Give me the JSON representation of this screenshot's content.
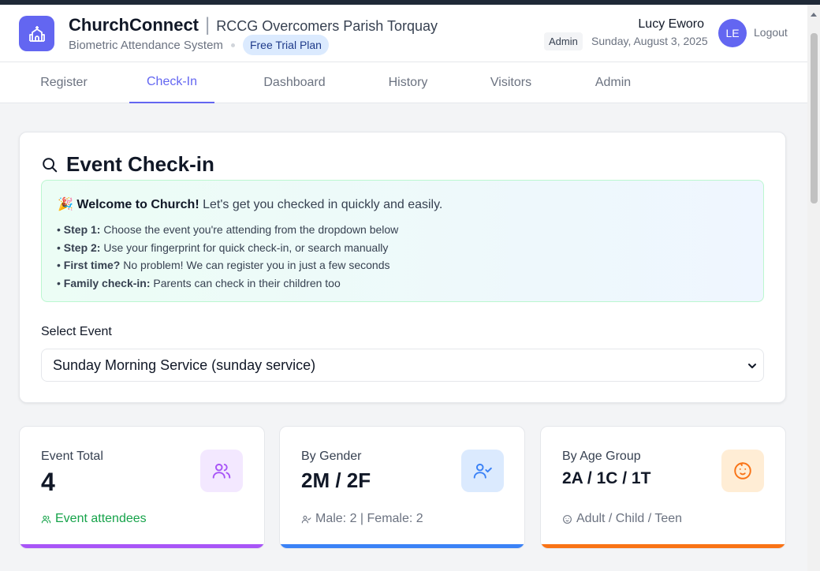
{
  "header": {
    "app_name": "ChurchConnect",
    "separator": "|",
    "parish": "RCCG Overcomers Parish Torquay",
    "system": "Biometric Attendance System",
    "plan_badge": "Free Trial Plan",
    "user_name": "Lucy Eworo",
    "role": "Admin",
    "date": "Sunday, August 3, 2025",
    "avatar_initials": "LE",
    "logout_label": "Logout"
  },
  "nav": {
    "tabs": [
      {
        "label": "Register"
      },
      {
        "label": "Check-In",
        "active": true
      },
      {
        "label": "Dashboard"
      },
      {
        "label": "History"
      },
      {
        "label": "Visitors"
      },
      {
        "label": "Admin"
      }
    ]
  },
  "checkin": {
    "title": "Event Check-in",
    "welcome_emoji": "🎉",
    "welcome_bold": "Welcome to Church!",
    "welcome_text": " Let's get you checked in quickly and easily.",
    "steps": [
      {
        "bold": "Step 1:",
        "text": " Choose the event you're attending from the dropdown below"
      },
      {
        "bold": "Step 2:",
        "text": " Use your fingerprint for quick check-in, or search manually"
      },
      {
        "bold": "First time?",
        "text": " No problem! We can register you in just a few seconds"
      },
      {
        "bold": "Family check-in:",
        "text": " Parents can check in their children too"
      }
    ],
    "select_label": "Select Event",
    "selected_event": "Sunday Morning Service (sunday service)"
  },
  "stats": [
    {
      "label": "Event Total",
      "value": "4",
      "foot": "Event attendees",
      "foot_color": "#16a34a",
      "icon": "users-icon",
      "bar_color": "#a855f7"
    },
    {
      "label": "By Gender",
      "value": "2M / 2F",
      "foot": "Male: 2 | Female: 2",
      "foot_color": "#6b7280",
      "icon": "user-check-icon",
      "bar_color": "#3b82f6"
    },
    {
      "label": "By Age Group",
      "value": "2A / 1C / 1T",
      "foot": "Adult / Child / Teen",
      "foot_color": "#6b7280",
      "icon": "baby-icon",
      "bar_color": "#f97316"
    }
  ]
}
